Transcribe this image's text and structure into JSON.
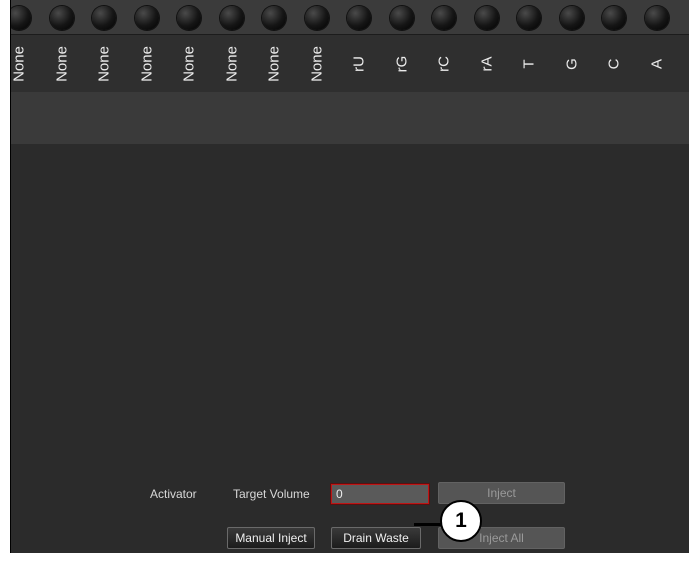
{
  "reagent_labels": [
    "None",
    "None",
    "None",
    "None",
    "None",
    "None",
    "None",
    "None",
    "rU",
    "rG",
    "rC",
    "rA",
    "T",
    "G",
    "C",
    "A"
  ],
  "controls": {
    "activator_label": "Activator",
    "target_volume_label": "Target Volume",
    "target_volume_value": "0",
    "inject_label": "Inject",
    "manual_inject_label": "Manual Inject",
    "drain_waste_label": "Drain Waste",
    "inject_all_label": "Inject All"
  },
  "callout": {
    "number": "1"
  },
  "colors": {
    "input_border": "#c01515",
    "background": "#2a2a2a"
  }
}
